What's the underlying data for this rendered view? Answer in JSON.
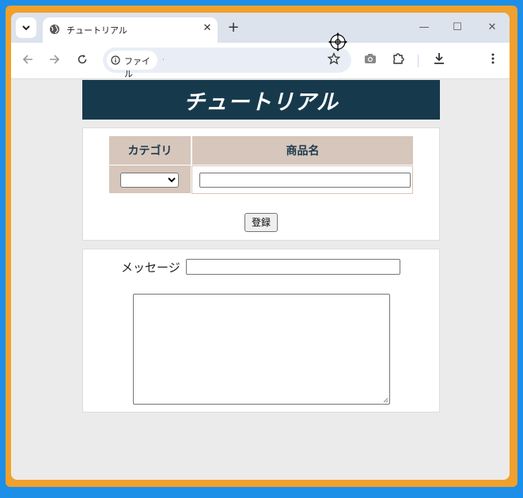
{
  "browser": {
    "tab_title": "チュートリアル",
    "tab_close_glyph": "✕",
    "new_tab_glyph": "+",
    "minimize_glyph": "—",
    "maximize_glyph": "☐",
    "close_glyph": "✕",
    "address_chip_label": "ファイル",
    "address_text": "·",
    "icons": {
      "tab_search": "chevron-down-icon",
      "favicon": "globe-icon",
      "back": "arrow-left-icon",
      "forward": "arrow-right-icon",
      "reload": "reload-icon",
      "info": "info-icon",
      "bookmark": "star-icon",
      "screenshot": "camera-icon",
      "extensions": "puzzle-icon",
      "download": "download-icon",
      "menu": "more-vertical-icon"
    }
  },
  "page": {
    "header_title": "チュートリアル",
    "form": {
      "category_header": "カテゴリ",
      "name_header": "商品名",
      "category_selected": "",
      "name_value": "",
      "register_label": "登録"
    },
    "message": {
      "label": "メッセージ",
      "input_value": "",
      "textarea_value": ""
    }
  },
  "colors": {
    "header_bg": "#163a4c",
    "table_header_bg": "#d6c6bb",
    "frame_border": "#f0a02c",
    "desktop": "#1e8fe8"
  }
}
